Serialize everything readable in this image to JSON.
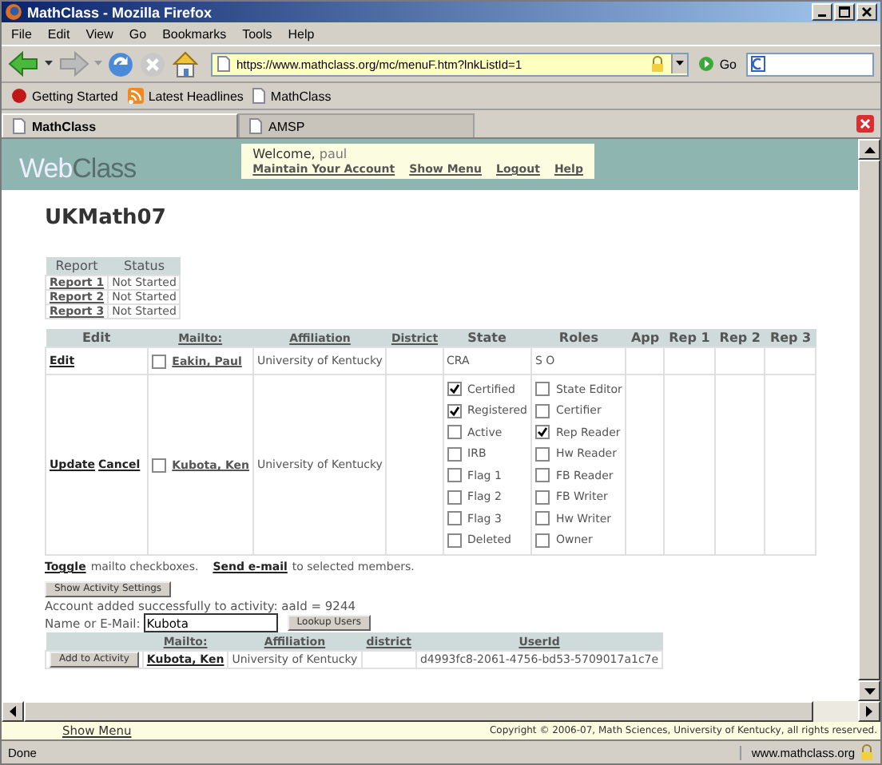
{
  "window": {
    "title": "MathClass - Mozilla Firefox"
  },
  "menu": [
    "File",
    "Edit",
    "View",
    "Go",
    "Bookmarks",
    "Tools",
    "Help"
  ],
  "toolbar": {
    "url": "https://www.mathclass.org/mc/menuF.htm?lnkListId=1",
    "go": "Go"
  },
  "bookmarks": [
    "Getting Started",
    "Latest Headlines",
    "MathClass"
  ],
  "tabs": [
    {
      "label": "MathClass",
      "selected": true
    },
    {
      "label": "AMSP",
      "selected": false
    }
  ],
  "header": {
    "logo_parts": [
      "Web",
      "Class"
    ],
    "welcome": "Welcome,",
    "user": "paul",
    "links": [
      "Maintain Your Account",
      "Show Menu",
      "Logout",
      "Help"
    ]
  },
  "page_title": "UKMath07",
  "reports": {
    "columns": [
      "Report",
      "Status"
    ],
    "rows": [
      {
        "report": "Report 1",
        "status": "Not Started"
      },
      {
        "report": "Report 2",
        "status": "Not Started"
      },
      {
        "report": "Report 3",
        "status": "Not Started"
      }
    ]
  },
  "members": {
    "columns": [
      {
        "label": "Edit",
        "link": false
      },
      {
        "label": "Mailto:",
        "link": true
      },
      {
        "label": "Affiliation",
        "link": true
      },
      {
        "label": "District",
        "link": true
      },
      {
        "label": "State",
        "link": false
      },
      {
        "label": "Roles",
        "link": false
      },
      {
        "label": "App",
        "link": false
      },
      {
        "label": "Rep 1",
        "link": false
      },
      {
        "label": "Rep 2",
        "link": false
      },
      {
        "label": "Rep 3",
        "link": false
      }
    ],
    "rows": [
      {
        "kind": "view",
        "actions": [
          "Edit"
        ],
        "mailto": false,
        "name": "Eakin, Paul",
        "affiliation": "University of Kentucky",
        "state": "CRA",
        "roles": "S O"
      },
      {
        "kind": "edit",
        "actions": [
          "Update",
          "Cancel"
        ],
        "mailto": false,
        "name": "Kubota, Ken",
        "affiliation": "University of Kentucky",
        "states": [
          {
            "label": "Certified",
            "checked": true
          },
          {
            "label": "Registered",
            "checked": true
          },
          {
            "label": "Active",
            "checked": false
          },
          {
            "label": "IRB",
            "checked": false
          },
          {
            "label": "Flag 1",
            "checked": false
          },
          {
            "label": "Flag 2",
            "checked": false
          },
          {
            "label": "Flag 3",
            "checked": false
          },
          {
            "label": "Deleted",
            "checked": false
          }
        ],
        "roles": [
          {
            "label": "State Editor",
            "checked": false
          },
          {
            "label": "Certifier",
            "checked": false
          },
          {
            "label": "Rep Reader",
            "checked": true
          },
          {
            "label": "Hw Reader",
            "checked": false
          },
          {
            "label": "FB Reader",
            "checked": false
          },
          {
            "label": "FB Writer",
            "checked": false
          },
          {
            "label": "Hw Writer",
            "checked": false
          },
          {
            "label": "Owner",
            "checked": false
          }
        ]
      }
    ]
  },
  "toggle_line": [
    {
      "kind": "link",
      "text": "Toggle"
    },
    {
      "kind": "text",
      "text": "mailto checkboxes."
    },
    {
      "kind": "link",
      "text": "Send e-mail"
    },
    {
      "kind": "text",
      "text": "to selected members."
    }
  ],
  "activity_button": "Show Activity Settings",
  "message": "Account added successfully to activity: aaId = 9244",
  "lookup": {
    "label": "Name or E-Mail:",
    "value": "Kubota",
    "button": "Lookup Users"
  },
  "results": {
    "columns": [
      {
        "label": "Mailto:"
      },
      {
        "label": "Affiliation"
      },
      {
        "label": "district"
      },
      {
        "label": "UserId"
      }
    ],
    "rows": [
      {
        "button": "Add to Activity",
        "name": "Kubota, Ken",
        "affiliation": "University of Kentucky",
        "user_id": "d4993fc8-2061-4756-bd53-5709017a1c7e"
      }
    ]
  },
  "footer": {
    "link": "Show Menu",
    "copyright": "Copyright © 2006-07, Math Sciences, University of Kentucky, all rights reserved."
  },
  "status_bar": {
    "text": "Done",
    "domain": "www.mathclass.org"
  }
}
